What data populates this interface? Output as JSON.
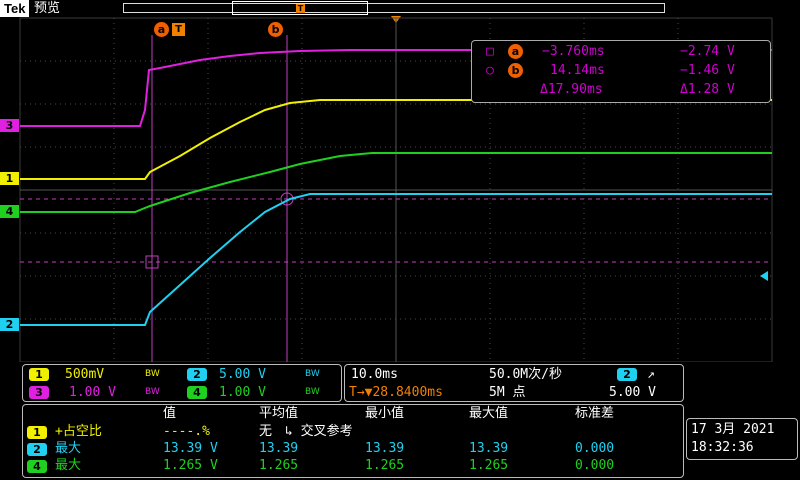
{
  "header": {
    "brand": "Tek",
    "mode": "预览",
    "record_marker": "T"
  },
  "channel_markers": [
    {
      "label": "3",
      "color": "#e020e0"
    },
    {
      "label": "1",
      "color": "#f0f000"
    },
    {
      "label": "4",
      "color": "#20d020"
    },
    {
      "label": "2",
      "color": "#20d0f0"
    }
  ],
  "cursors": {
    "a_label": "a",
    "b_label": "b",
    "trigger_label": "T"
  },
  "cursor_readout": {
    "a_time": "−3.760ms",
    "a_volt": "−2.74 V",
    "b_time": "14.14ms",
    "b_volt": "−1.46 V",
    "delta_time": "Δ17.90ms",
    "delta_volt": "Δ1.28 V",
    "a_symbol": "□",
    "b_symbol": "○"
  },
  "vertical": {
    "ch1_num": "1",
    "ch1_scale": "500mV",
    "ch2_num": "2",
    "ch2_scale": "5.00 V",
    "ch3_num": "3",
    "ch3_scale": "1.00 V",
    "ch4_num": "4",
    "ch4_scale": "1.00 V",
    "bw": "BW"
  },
  "horizontal": {
    "timebase": "10.0ms",
    "sample_rate": "50.0M次/秒",
    "trigger_pos": "T→▼28.8400ms",
    "record_length": "5M 点",
    "trig_src": "2",
    "trig_level": "5.00 V",
    "trig_slope": "↗"
  },
  "measurements": {
    "headers": [
      "值",
      "平均值",
      "最小值",
      "最大值",
      "标准差"
    ],
    "rows": [
      {
        "ch": "1",
        "name": "+占空比",
        "value": "----.%",
        "mean": "无",
        "mean_extra": "↳ 交叉参考",
        "min": "",
        "max": "",
        "std": "",
        "color": "#f0f000"
      },
      {
        "ch": "2",
        "name": "最大",
        "value": "13.39 V",
        "mean": "13.39",
        "mean_extra": "",
        "min": "13.39",
        "max": "13.39",
        "std": "0.000",
        "color": "#20d0f0"
      },
      {
        "ch": "4",
        "name": "最大",
        "value": "1.265 V",
        "mean": "1.265",
        "mean_extra": "",
        "min": "1.265",
        "max": "1.265",
        "std": "0.000",
        "color": "#20d020"
      }
    ]
  },
  "datetime": {
    "date": "17 3月  2021",
    "time": "18:32:36"
  }
}
